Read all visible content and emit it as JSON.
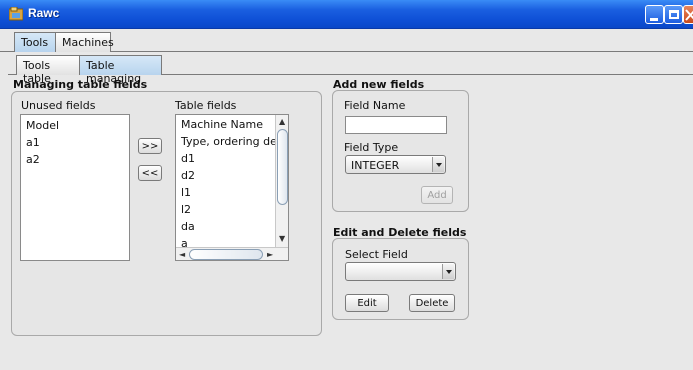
{
  "window": {
    "title": "Rawc"
  },
  "main_tabs": [
    {
      "label": "Tools"
    },
    {
      "label": "Machines"
    }
  ],
  "sub_tabs": [
    {
      "label": "Tools table"
    },
    {
      "label": "Table managing"
    }
  ],
  "managing": {
    "title": "Managing table fields",
    "unused_label": "Unused fields",
    "unused_items": [
      "Model",
      "a1",
      "a2"
    ],
    "table_label": "Table fields",
    "table_items": [
      "Machine Name",
      "Type, ordering descr.",
      "d1",
      "d2",
      "l1",
      "l2",
      "da",
      "a"
    ],
    "move_right_label": ">>",
    "move_left_label": "<<"
  },
  "add_new": {
    "title": "Add new fields",
    "field_name_label": "Field Name",
    "field_name_value": "",
    "field_type_label": "Field Type",
    "field_type_value": "INTEGER",
    "add_label": "Add"
  },
  "edit_delete": {
    "title": "Edit and Delete fields",
    "select_label": "Select Field",
    "select_value": "",
    "edit_label": "Edit",
    "delete_label": "Delete"
  }
}
